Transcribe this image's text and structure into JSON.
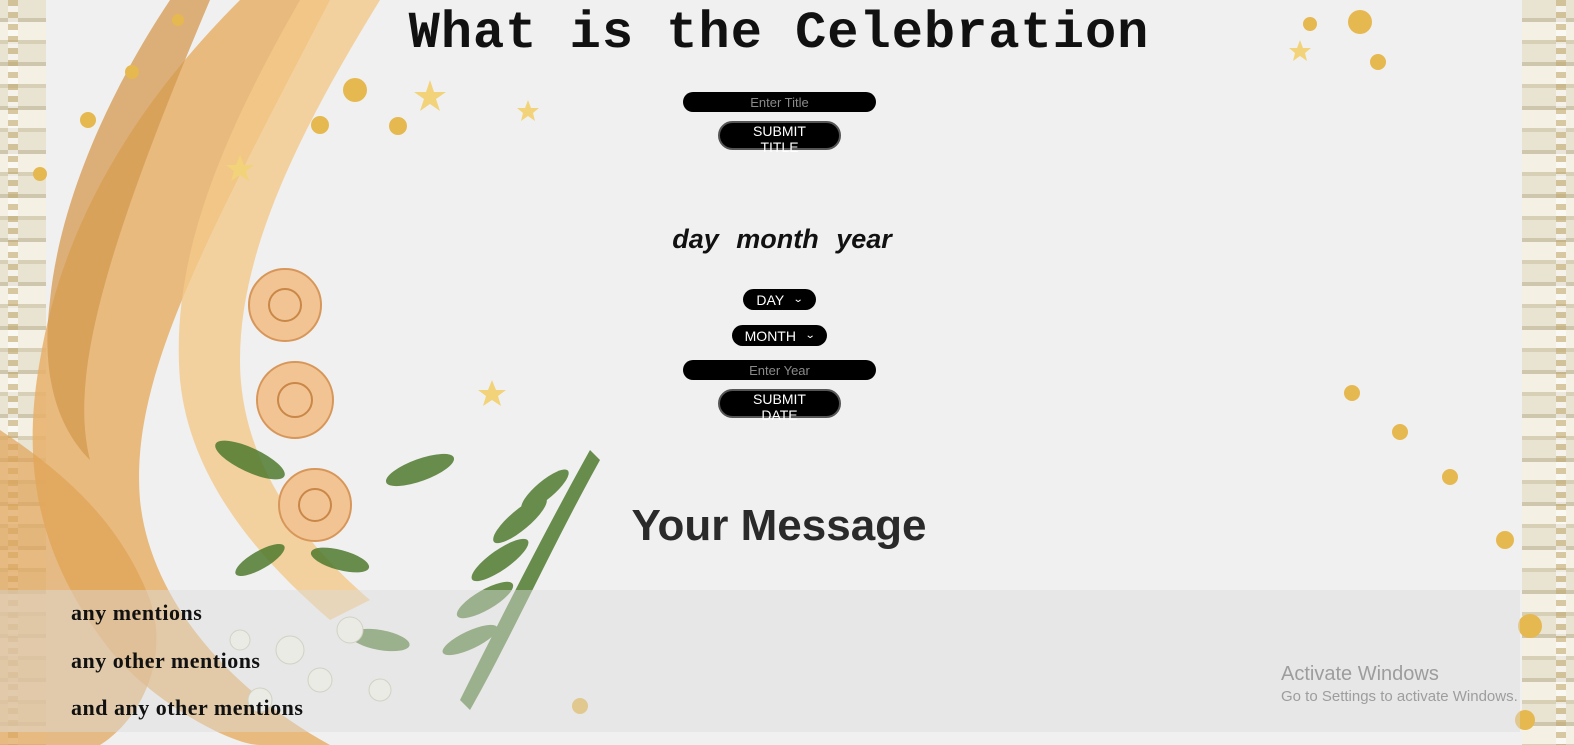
{
  "page": {
    "title": "What is the Celebration"
  },
  "title_form": {
    "input_placeholder": "Enter Title",
    "input_value": "",
    "submit_label": "SUBMIT TITLE"
  },
  "date_form": {
    "heading": "day  month  year",
    "day_select": {
      "selected": "DAY"
    },
    "month_select": {
      "selected": "MONTH"
    },
    "year_input_placeholder": "Enter Year",
    "year_input_value": "",
    "submit_label": "SUBMIT DATE"
  },
  "message": {
    "heading": "Your Message",
    "mentions": [
      "any mentions",
      "any other mentions",
      "and any other mentions"
    ]
  },
  "os_watermark": {
    "line1": "Activate Windows",
    "line2": "Go to Settings to activate Windows."
  },
  "colors": {
    "background": "#f0f0f0",
    "pill": "#000000",
    "gold": "#e0a94a",
    "leaf": "#4f7a2f",
    "rose": "#f3c493"
  }
}
